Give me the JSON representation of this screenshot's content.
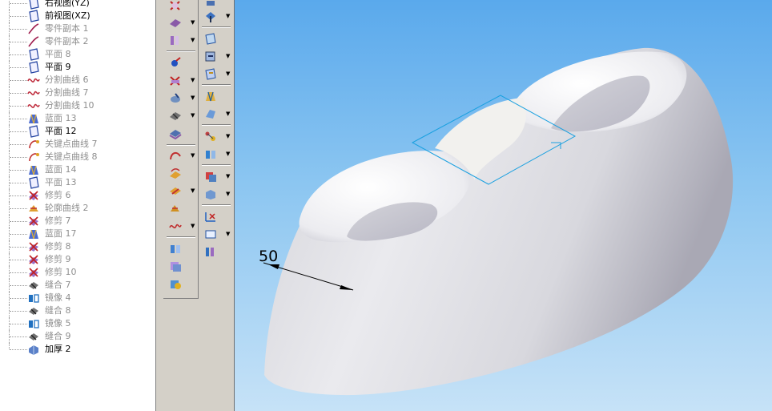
{
  "tree": {
    "items": [
      {
        "label": "右视图(YZ)",
        "icon": "datum-plane-icon",
        "active": true
      },
      {
        "label": "前视图(XZ)",
        "icon": "datum-plane-icon",
        "active": true
      },
      {
        "label": "零件副本 1",
        "icon": "curve-icon",
        "active": false
      },
      {
        "label": "零件副本 2",
        "icon": "curve-icon",
        "active": false
      },
      {
        "label": "平面 8",
        "icon": "datum-plane-icon",
        "active": false
      },
      {
        "label": "平面 9",
        "icon": "datum-plane-icon",
        "active": true
      },
      {
        "label": "分割曲线 6",
        "icon": "split-curve-icon",
        "active": false
      },
      {
        "label": "分割曲线 7",
        "icon": "split-curve-icon",
        "active": false
      },
      {
        "label": "分割曲线 10",
        "icon": "split-curve-icon",
        "active": false
      },
      {
        "label": "蓝面 13",
        "icon": "lofted-surface-icon",
        "active": false
      },
      {
        "label": "平面 12",
        "icon": "datum-plane-icon",
        "active": true
      },
      {
        "label": "关键点曲线 7",
        "icon": "keypoint-curve-icon",
        "active": false
      },
      {
        "label": "关键点曲线 8",
        "icon": "keypoint-curve-icon",
        "active": false
      },
      {
        "label": "蓝面 14",
        "icon": "lofted-surface-icon",
        "active": false
      },
      {
        "label": "平面 13",
        "icon": "datum-plane-icon",
        "active": false
      },
      {
        "label": "修剪 6",
        "icon": "trim-icon",
        "active": false
      },
      {
        "label": "轮廓曲线 2",
        "icon": "silhouette-curve-icon",
        "active": false
      },
      {
        "label": "修剪 7",
        "icon": "trim-icon",
        "active": false
      },
      {
        "label": "蓝面 17",
        "icon": "lofted-surface-icon",
        "active": false
      },
      {
        "label": "修剪 8",
        "icon": "trim-icon",
        "active": false
      },
      {
        "label": "修剪 9",
        "icon": "trim-icon",
        "active": false
      },
      {
        "label": "修剪 10",
        "icon": "trim-icon",
        "active": false
      },
      {
        "label": "缝合 7",
        "icon": "sew-icon",
        "active": false
      },
      {
        "label": "镜像 4",
        "icon": "mirror-icon",
        "active": false
      },
      {
        "label": "缝合 8",
        "icon": "sew-icon",
        "active": false
      },
      {
        "label": "镜像 5",
        "icon": "mirror-icon",
        "active": false
      },
      {
        "label": "缝合 9",
        "icon": "sew-icon",
        "active": false
      },
      {
        "label": "加厚 2",
        "icon": "thicken-icon",
        "active": true
      }
    ]
  },
  "viewport": {
    "dimension_label": "50"
  },
  "colors": {
    "sky_top": "#5aa9ec",
    "sky_bottom": "#c6e2f7",
    "surface": "#e6e6ec",
    "hole_inner": "#bdbccb",
    "plane_outline": "#1aa0e0",
    "inactive_text": "#8f8f8f"
  }
}
